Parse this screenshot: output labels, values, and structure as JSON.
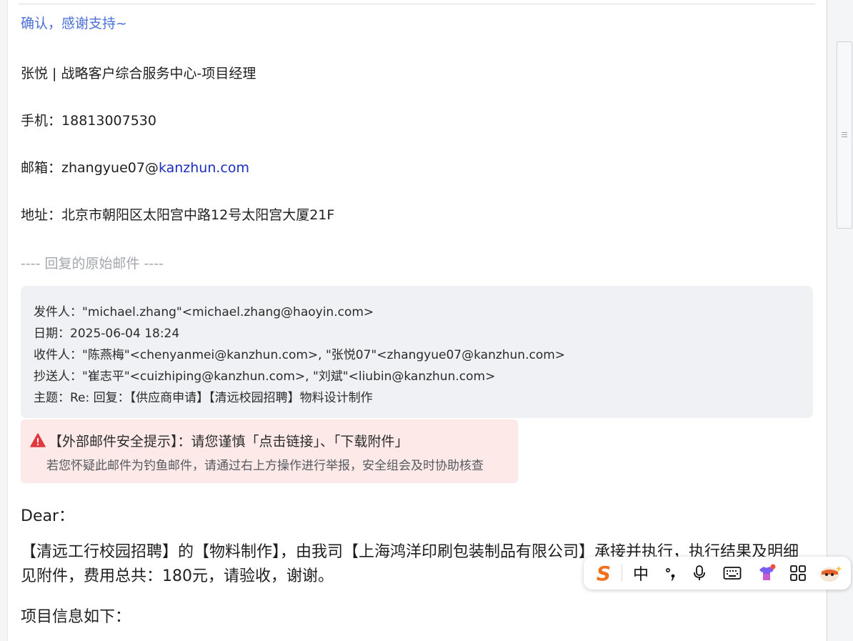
{
  "email": {
    "thanks_line": "确认，感谢支持~",
    "signature": {
      "name_title": "张悦 | 战略客户综合服务中心-项目经理",
      "mobile_label": "手机：",
      "mobile": "18813007530",
      "email_label": "邮箱：",
      "email_user": "zhangyue07@",
      "email_domain": "kanzhun.com",
      "address_label": "地址：",
      "address": "北京市朝阳区太阳宫中路12号太阳宫大厦21F"
    },
    "original_divider": "---- 回复的原始邮件 ----",
    "original_header": {
      "from": "发件人：\"michael.zhang\"<michael.zhang@haoyin.com>",
      "date": "日期：2025-06-04 18:24",
      "to": "收件人：\"陈燕梅\"<chenyanmei@kanzhun.com>, \"张悦07\"<zhangyue07@kanzhun.com>",
      "cc": "抄送人：\"崔志平\"<cuizhiping@kanzhun.com>, \"刘斌\"<liubin@kanzhun.com>",
      "subject": "主题：Re: 回复：【供应商申请】【清远校园招聘】物料设计制作"
    },
    "security_warning": {
      "title": "【外部邮件安全提示】：请您谨慎「点击链接」、「下载附件」",
      "subtitle": "若您怀疑此邮件为钓鱼邮件，请通过右上方操作进行举报，安全组会及时协助核查",
      "color": "#e0393e"
    },
    "body": {
      "greeting": "Dear：",
      "paragraph": "【清远工行校园招聘】的【物料制作】，由我司【上海鸿洋印刷包装制品有限公司】承接并执行，执行结果及明细见附件，费用总共：180元，请验收，谢谢。",
      "items_title": "项目信息如下："
    }
  },
  "ime_toolbar": {
    "logo": "S",
    "mode": "中",
    "items": [
      "sogou-logo-icon",
      "mode-zh",
      "punctuation-icon",
      "microphone-icon",
      "keyboard-icon",
      "skin-shirt-icon",
      "grid-apps-icon",
      "mascot-icon"
    ],
    "accent": "#f0701d"
  }
}
